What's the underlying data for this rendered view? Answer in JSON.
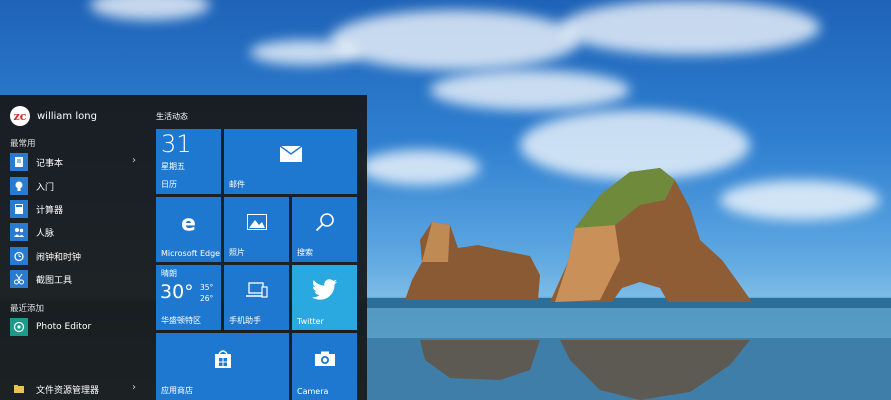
{
  "start_menu": {
    "user": {
      "avatar_text": "zc",
      "name": "william long"
    },
    "most_used_label": "最常用",
    "most_used": [
      {
        "label": "记事本",
        "icon": "notepad-icon"
      },
      {
        "label": "入门",
        "icon": "lightbulb-icon"
      },
      {
        "label": "计算器",
        "icon": "calculator-icon"
      },
      {
        "label": "人脉",
        "icon": "people-icon"
      },
      {
        "label": "闹钟和时钟",
        "icon": "alarm-clock-icon"
      },
      {
        "label": "截图工具",
        "icon": "scissors-icon"
      }
    ],
    "recently_added_label": "最近添加",
    "recently_added": [
      {
        "label": "Photo Editor",
        "icon": "photo-editor-icon"
      }
    ],
    "file_explorer": {
      "label": "文件资源管理器",
      "icon": "folder-icon"
    },
    "tiles_group_title": "生活动态",
    "tiles": {
      "calendar": {
        "day": "31",
        "weekday": "星期五",
        "label": "日历"
      },
      "mail": {
        "label": "邮件"
      },
      "edge": {
        "label": "Microsoft Edge"
      },
      "photos": {
        "label": "照片"
      },
      "search": {
        "label": "搜索"
      },
      "weather": {
        "condition": "晴朗",
        "temp": "30°",
        "high": "35°",
        "low": "26°",
        "label": "华盛顿特区"
      },
      "phone": {
        "label": "手机助手"
      },
      "twitter": {
        "label": "Twitter"
      },
      "store": {
        "label": "应用商店"
      },
      "camera": {
        "label": "Camera"
      }
    },
    "colors": {
      "tile": "#1f78cf",
      "menu_bg": "#181818",
      "twitter": "#2aa9e0"
    }
  }
}
